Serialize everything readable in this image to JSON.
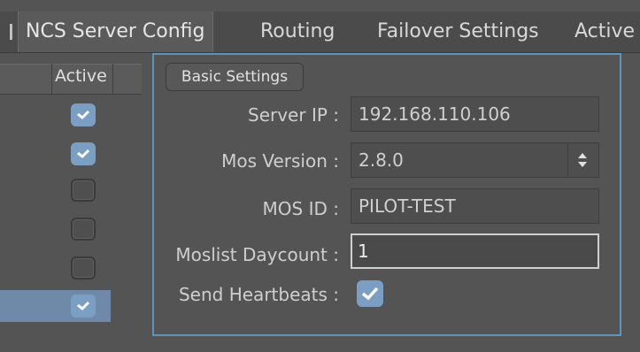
{
  "tabs": [
    {
      "label": "NCS Server Config",
      "active": true
    },
    {
      "label": "Routing",
      "active": false
    },
    {
      "label": "Failover Settings",
      "active": false
    },
    {
      "label": "Active",
      "active": false
    }
  ],
  "list": {
    "header": "Active",
    "rows": [
      {
        "active": true,
        "selected": false
      },
      {
        "active": true,
        "selected": false
      },
      {
        "active": false,
        "selected": false
      },
      {
        "active": false,
        "selected": false
      },
      {
        "active": false,
        "selected": false
      },
      {
        "active": true,
        "selected": true
      }
    ]
  },
  "settings": {
    "group_label": "Basic Settings",
    "server_ip": {
      "label": "Server IP :",
      "value": "192.168.110.106"
    },
    "mos_version": {
      "label": "Mos Version :",
      "value": "2.8.0"
    },
    "mos_id": {
      "label": "MOS ID :",
      "value": "PILOT-TEST"
    },
    "moslist_daycount": {
      "label": "Moslist Daycount :",
      "value": "1"
    },
    "send_heartbeats": {
      "label": "Send Heartbeats :",
      "checked": true
    }
  },
  "colors": {
    "accent": "#7b9ec3",
    "panel_border": "#5e93bb",
    "selected_row": "#6f8aa8"
  }
}
